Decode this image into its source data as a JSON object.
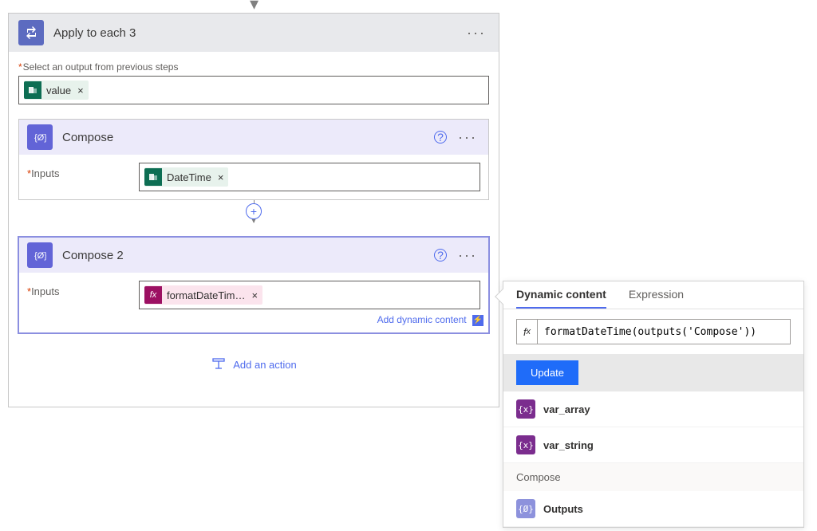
{
  "loop": {
    "title": "Apply to each 3",
    "output_label": "Select an output from previous steps",
    "output_token": "value"
  },
  "compose1": {
    "title": "Compose",
    "inputs_label": "Inputs",
    "token": "DateTime"
  },
  "compose2": {
    "title": "Compose 2",
    "inputs_label": "Inputs",
    "token": "formatDateTim…",
    "dyn_link": "Add dynamic content"
  },
  "add_action": "Add an action",
  "dcp": {
    "tab_dynamic": "Dynamic content",
    "tab_expression": "Expression",
    "fx_value": "formatDateTime(outputs('Compose'))",
    "update": "Update",
    "items": [
      {
        "label": "var_array"
      },
      {
        "label": "var_string"
      }
    ],
    "section": "Compose",
    "outputs": "Outputs"
  }
}
